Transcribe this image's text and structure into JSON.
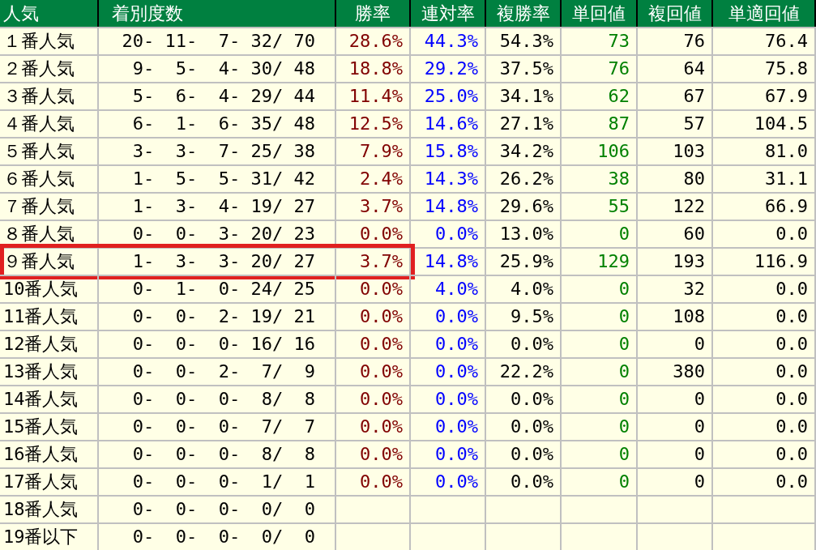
{
  "columns": [
    "人気",
    "着別度数",
    "勝率",
    "連対率",
    "複勝率",
    "単回値",
    "複回値",
    "単適回値"
  ],
  "rows": [
    {
      "rank": "１番人気",
      "record": "20- 11-  7- 32/ 70",
      "win": "28.6%",
      "quinella": "44.3%",
      "show": "54.3%",
      "win_return": "73",
      "show_return": "76",
      "adj_return": "76.4",
      "highlighted": false
    },
    {
      "rank": "２番人気",
      "record": "9-  5-  4- 30/ 48",
      "win": "18.8%",
      "quinella": "29.2%",
      "show": "37.5%",
      "win_return": "76",
      "show_return": "64",
      "adj_return": "75.8",
      "highlighted": false
    },
    {
      "rank": "３番人気",
      "record": "5-  6-  4- 29/ 44",
      "win": "11.4%",
      "quinella": "25.0%",
      "show": "34.1%",
      "win_return": "62",
      "show_return": "67",
      "adj_return": "67.9",
      "highlighted": false
    },
    {
      "rank": "４番人気",
      "record": "6-  1-  6- 35/ 48",
      "win": "12.5%",
      "quinella": "14.6%",
      "show": "27.1%",
      "win_return": "87",
      "show_return": "57",
      "adj_return": "104.5",
      "highlighted": false
    },
    {
      "rank": "５番人気",
      "record": "3-  3-  7- 25/ 38",
      "win": "7.9%",
      "quinella": "15.8%",
      "show": "34.2%",
      "win_return": "106",
      "show_return": "103",
      "adj_return": "81.0",
      "highlighted": false
    },
    {
      "rank": "６番人気",
      "record": "1-  5-  5- 31/ 42",
      "win": "2.4%",
      "quinella": "14.3%",
      "show": "26.2%",
      "win_return": "38",
      "show_return": "80",
      "adj_return": "31.1",
      "highlighted": false
    },
    {
      "rank": "７番人気",
      "record": "1-  3-  4- 19/ 27",
      "win": "3.7%",
      "quinella": "14.8%",
      "show": "29.6%",
      "win_return": "55",
      "show_return": "122",
      "adj_return": "66.9",
      "highlighted": false
    },
    {
      "rank": "８番人気",
      "record": "0-  0-  3- 20/ 23",
      "win": "0.0%",
      "quinella": "0.0%",
      "show": "13.0%",
      "win_return": "0",
      "show_return": "60",
      "adj_return": "0.0",
      "highlighted": false
    },
    {
      "rank": "９番人気",
      "record": "1-  3-  3- 20/ 27",
      "win": "3.7%",
      "quinella": "14.8%",
      "show": "25.9%",
      "win_return": "129",
      "show_return": "193",
      "adj_return": "116.9",
      "highlighted": true
    },
    {
      "rank": "10番人気",
      "record": "0-  1-  0- 24/ 25",
      "win": "0.0%",
      "quinella": "4.0%",
      "show": "4.0%",
      "win_return": "0",
      "show_return": "32",
      "adj_return": "0.0",
      "highlighted": false
    },
    {
      "rank": "11番人気",
      "record": "0-  0-  2- 19/ 21",
      "win": "0.0%",
      "quinella": "0.0%",
      "show": "9.5%",
      "win_return": "0",
      "show_return": "108",
      "adj_return": "0.0",
      "highlighted": false
    },
    {
      "rank": "12番人気",
      "record": "0-  0-  0- 16/ 16",
      "win": "0.0%",
      "quinella": "0.0%",
      "show": "0.0%",
      "win_return": "0",
      "show_return": "0",
      "adj_return": "0.0",
      "highlighted": false
    },
    {
      "rank": "13番人気",
      "record": "0-  0-  2-  7/  9",
      "win": "0.0%",
      "quinella": "0.0%",
      "show": "22.2%",
      "win_return": "0",
      "show_return": "380",
      "adj_return": "0.0",
      "highlighted": false
    },
    {
      "rank": "14番人気",
      "record": "0-  0-  0-  8/  8",
      "win": "0.0%",
      "quinella": "0.0%",
      "show": "0.0%",
      "win_return": "0",
      "show_return": "0",
      "adj_return": "0.0",
      "highlighted": false
    },
    {
      "rank": "15番人気",
      "record": "0-  0-  0-  7/  7",
      "win": "0.0%",
      "quinella": "0.0%",
      "show": "0.0%",
      "win_return": "0",
      "show_return": "0",
      "adj_return": "0.0",
      "highlighted": false
    },
    {
      "rank": "16番人気",
      "record": "0-  0-  0-  8/  8",
      "win": "0.0%",
      "quinella": "0.0%",
      "show": "0.0%",
      "win_return": "0",
      "show_return": "0",
      "adj_return": "0.0",
      "highlighted": false
    },
    {
      "rank": "17番人気",
      "record": "0-  0-  0-  1/  1",
      "win": "0.0%",
      "quinella": "0.0%",
      "show": "0.0%",
      "win_return": "0",
      "show_return": "0",
      "adj_return": "0.0",
      "highlighted": false
    },
    {
      "rank": "18番人気",
      "record": "0-  0-  0-  0/  0",
      "highlighted": false
    },
    {
      "rank": "19番以下",
      "record": "0-  0-  0-  0/  0",
      "highlighted": false
    }
  ]
}
